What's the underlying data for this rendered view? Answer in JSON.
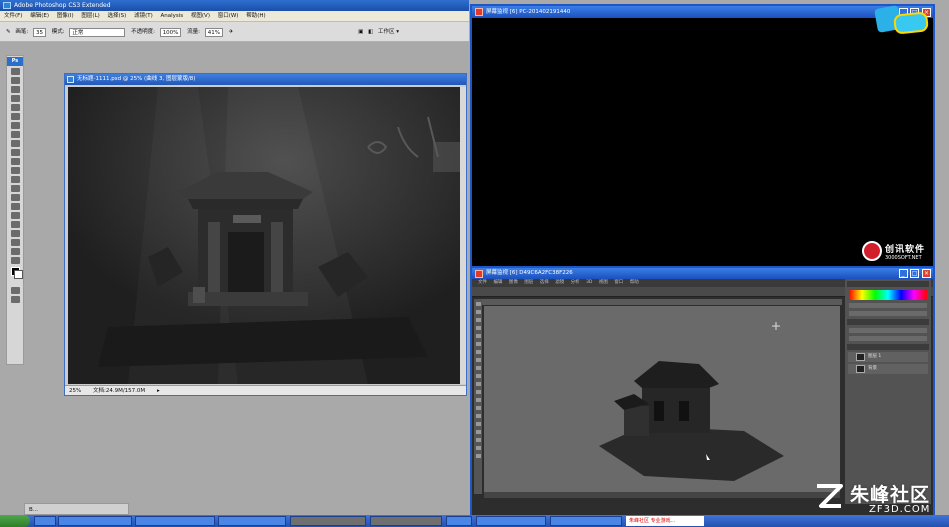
{
  "photoshop": {
    "title": "Adobe Photoshop CS3 Extended",
    "menu": [
      "文件(F)",
      "编辑(E)",
      "图像(I)",
      "图层(L)",
      "选择(S)",
      "滤镜(T)",
      "Analysis",
      "视图(V)",
      "窗口(W)",
      "帮助(H)"
    ],
    "options": {
      "brush_label": "画笔:",
      "brush_size": "35",
      "mode_label": "模式:",
      "mode_value": "正常",
      "opacity_label": "不透明度:",
      "opacity_value": "100%",
      "flow_label": "流量:",
      "flow_value": "41%",
      "workspace_label": "工作区 ▾"
    },
    "toolbox_badge": "Ps",
    "document": {
      "title": "无标题-1111.psd @ 25% (曲线 3, 图层蒙版/8)",
      "zoom": "25%",
      "doc_info": "文档:24.9M/157.0M"
    },
    "task_strip_label": "B..."
  },
  "monitor_top": {
    "title": "屏幕监视  [6]  PC-201402191440"
  },
  "monitor_bottom": {
    "title": "屏幕监视  [6]  D49C6A2FC38F226",
    "menu": [
      "文件",
      "编辑",
      "图像",
      "图层",
      "选择",
      "滤镜",
      "分析",
      "3D",
      "视图",
      "窗口",
      "帮助"
    ],
    "layer_names": [
      "图层 1",
      "背景"
    ]
  },
  "brand": {
    "name": "创讯软件",
    "url": "3000SOFT.NET"
  },
  "watermark": {
    "cn": "朱峰社区",
    "en": "ZF3D.COM"
  },
  "taskbar": {
    "tasks": [
      "",
      "",
      "",
      "",
      "",
      "",
      "",
      "",
      ""
    ],
    "red_notice": "朱峰社区 专业游戏..."
  }
}
